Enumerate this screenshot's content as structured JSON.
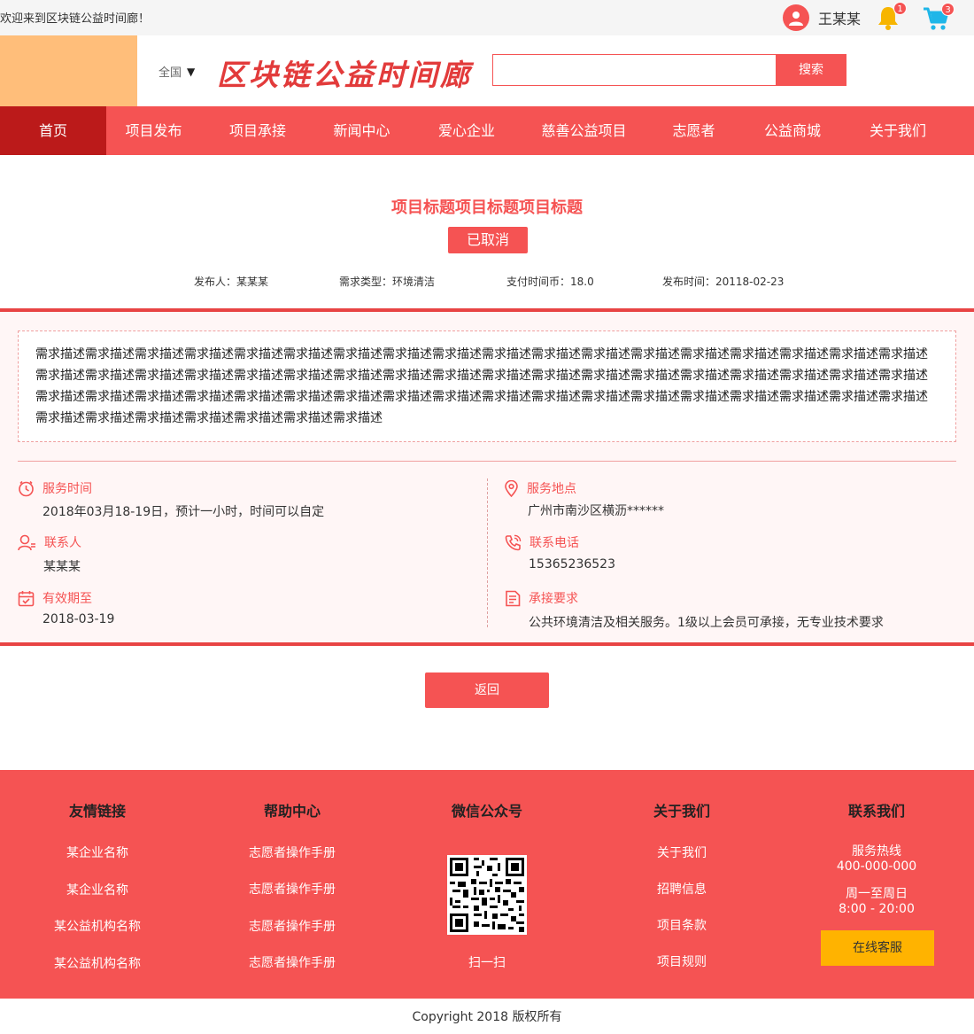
{
  "topbar": {
    "welcome": "欢迎来到区块链公益时间廊！",
    "username": "王某某",
    "notifications_count": "1",
    "cart_count": "3"
  },
  "header": {
    "region": "全国",
    "site_title": "区块链公益时间廊",
    "search_button": "搜索"
  },
  "nav": {
    "items": [
      {
        "label": "首页",
        "active": true
      },
      {
        "label": "项目发布"
      },
      {
        "label": "项目承接"
      },
      {
        "label": "新闻中心"
      },
      {
        "label": "爱心企业"
      },
      {
        "label": "慈善公益项目"
      },
      {
        "label": "志愿者"
      },
      {
        "label": "公益商城"
      },
      {
        "label": "关于我们"
      }
    ]
  },
  "project": {
    "title": "项目标题项目标题项目标题",
    "status": "已取消",
    "publisher": "发布人：某某某",
    "type": "需求类型：环境清洁",
    "pay": "支付时间币：18.0",
    "publish_time": "发布时间：20118-02-23",
    "description": "需求描述需求描述需求描述需求描述需求描述需求描述需求描述需求描述需求描述需求描述需求描述需求描述需求描述需求描述需求描述需求描述需求描述需求描述需求描述需求描述需求描述需求描述需求描述需求描述需求描述需求描述需求描述需求描述需求描述需求描述需求描述需求描述需求描述需求描述需求描述需求描述需求描述需求描述需求描述需求描述需求描述需求描述需求描述需求描述需求描述需求描述需求描述需求描述需求描述需求描述需求描述需求描述需求描述需求描述需求描述需求描述需求描述需求描述需求描述需求描述需求描述",
    "service_time_label": "服务时间",
    "service_time": "2018年03月18-19日，预计一小时，时间可以自定",
    "contact_label": "联系人",
    "contact": "某某某",
    "valid_label": "有效期至",
    "valid": "2018-03-19",
    "location_label": "服务地点",
    "location": "广州市南沙区横沥******",
    "phone_label": "联系电话",
    "phone": "15365236523",
    "requirement_label": "承接要求",
    "requirement": "公共环境清洁及相关服务。1级以上会员可承接，无专业技术要求",
    "back_button": "返回"
  },
  "footer": {
    "links_title": "友情链接",
    "links": [
      "某企业名称",
      "某企业名称",
      "某公益机构名称",
      "某公益机构名称"
    ],
    "help_title": "帮助中心",
    "help": [
      "志愿者操作手册",
      "志愿者操作手册",
      "志愿者操作手册",
      "志愿者操作手册"
    ],
    "wechat_title": "微信公众号",
    "wechat_caption": "扫一扫",
    "about_title": "关于我们",
    "about": [
      "关于我们",
      "招聘信息",
      "项目条款",
      "项目规则"
    ],
    "contact_title": "联系我们",
    "hotline_label": "服务热线",
    "hotline": "400-000-000",
    "hours_label": "周一至周日",
    "hours": "8:00 - 20:00",
    "kefu_button": "在线客服"
  },
  "copyright": "Copyright 2018 版权所有",
  "colors": {
    "brand": "#f55353",
    "nav_active": "#bb1a1a",
    "logo_block": "#ffbe7a",
    "kefu": "#ffb300",
    "cart_icon": "#1fb6e8",
    "bell_icon": "#f7b500"
  }
}
